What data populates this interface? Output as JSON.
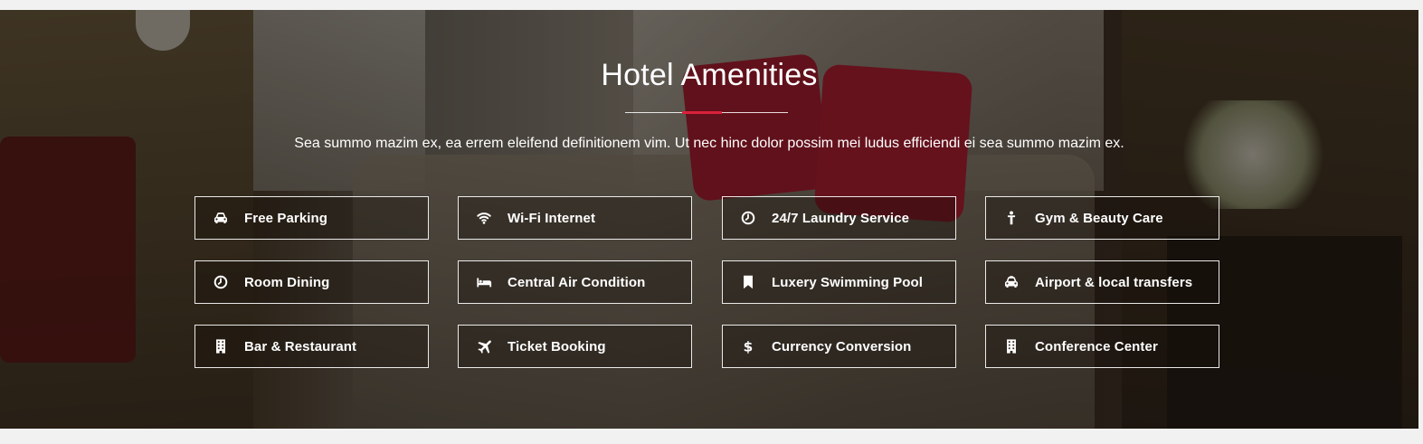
{
  "section": {
    "title": "Hotel Amenities",
    "subtitle": "Sea summo mazim ex, ea errem eleifend definitionem vim. Ut nec hinc dolor possim mei ludus efficiendi ei sea summo mazim ex.",
    "accent_color": "#d8213a"
  },
  "amenities": [
    {
      "label": "Free Parking",
      "icon": "car-icon"
    },
    {
      "label": "Wi-Fi Internet",
      "icon": "wifi-icon"
    },
    {
      "label": "24/7 Laundry Service",
      "icon": "clock-icon"
    },
    {
      "label": "Gym & Beauty Care",
      "icon": "person-icon"
    },
    {
      "label": "Room Dining",
      "icon": "clock-icon"
    },
    {
      "label": "Central Air Condition",
      "icon": "bed-icon"
    },
    {
      "label": "Luxery Swimming Pool",
      "icon": "bookmark-icon"
    },
    {
      "label": "Airport & local transfers",
      "icon": "taxi-icon"
    },
    {
      "label": "Bar & Restaurant",
      "icon": "building-icon"
    },
    {
      "label": "Ticket Booking",
      "icon": "plane-icon"
    },
    {
      "label": "Currency Conversion",
      "icon": "dollar-icon"
    },
    {
      "label": "Conference Center",
      "icon": "building-icon"
    }
  ]
}
